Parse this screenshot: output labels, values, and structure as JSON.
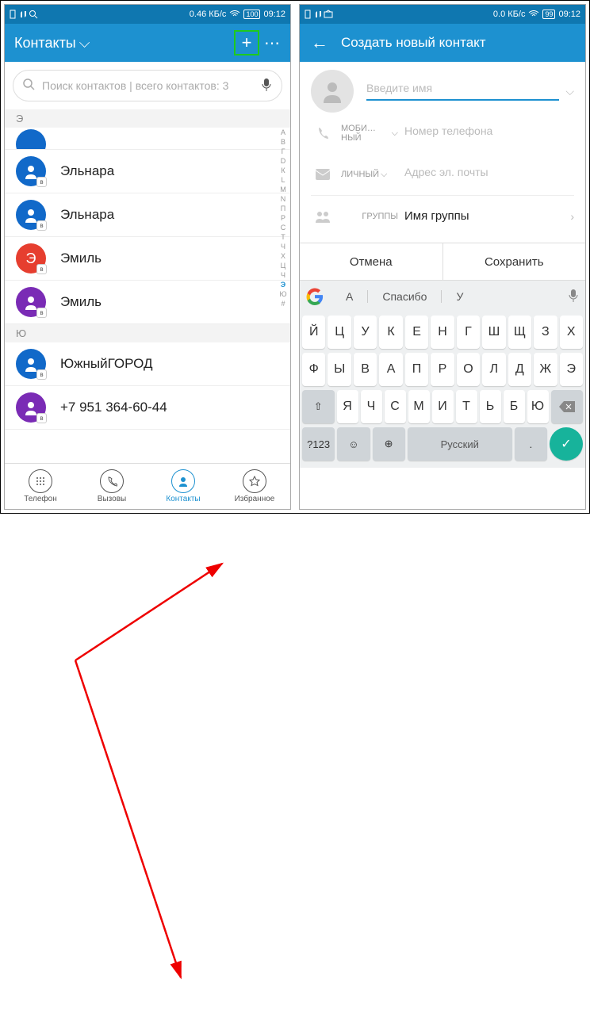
{
  "status": {
    "speed1": "0.46 КБ/с",
    "speed2": "0.0 КБ/с",
    "batt": "100",
    "batt2": "99",
    "time": "09:12"
  },
  "left": {
    "header": "Контакты",
    "search_placeholder": "Поиск контактов | всего контактов: 3",
    "sections": [
      "Э",
      "Ю"
    ],
    "contacts": [
      {
        "name": "Эльнара",
        "color": "#1169c9"
      },
      {
        "name": "Эльнара",
        "color": "#1169c9"
      },
      {
        "name": "Эмиль",
        "color": "#e63e2f",
        "letter": "Э"
      },
      {
        "name": "Эмиль",
        "color": "#7a2bb5"
      }
    ],
    "yu": [
      {
        "name": "ЮжныйГОРОД",
        "color": "#1169c9"
      },
      {
        "name": "+7 951 364-60-44",
        "color": "#7a2bb5"
      }
    ],
    "index": [
      "А",
      "B",
      "Г",
      "D",
      "К",
      "L",
      "М",
      "N",
      "П",
      "Р",
      "С",
      "Т",
      "Ч",
      "Х",
      "Ц",
      "Ч",
      "Э",
      "Ю",
      "#"
    ],
    "nav": [
      {
        "l": "Телефон"
      },
      {
        "l": "Вызовы"
      },
      {
        "l": "Контакты"
      },
      {
        "l": "Избранное"
      }
    ]
  },
  "right": {
    "header": "Создать новый контакт",
    "name_ph": "Введите имя",
    "phone_lab": "МОБИ…НЫЙ",
    "phone_ph": "Номер телефона",
    "email_lab": "ЛИЧНЫЙ",
    "email_ph": "Адрес эл. почты",
    "group_lab": "ГРУППЫ",
    "group_val": "Имя группы",
    "cancel": "Отмена",
    "save": "Сохранить",
    "sugg": [
      "А",
      "Спасибо",
      "У"
    ],
    "rows": [
      [
        "Й",
        "Ц",
        "У",
        "К",
        "Е",
        "Н",
        "Г",
        "Ш",
        "Щ",
        "З",
        "Х"
      ],
      [
        "Ф",
        "Ы",
        "В",
        "А",
        "П",
        "Р",
        "О",
        "Л",
        "Д",
        "Ж",
        "Э"
      ],
      [
        "Я",
        "Ч",
        "С",
        "М",
        "И",
        "Т",
        "Ь",
        "Б",
        "Ю"
      ]
    ],
    "fn": {
      "num": "?123",
      "lang": "Русский"
    }
  }
}
